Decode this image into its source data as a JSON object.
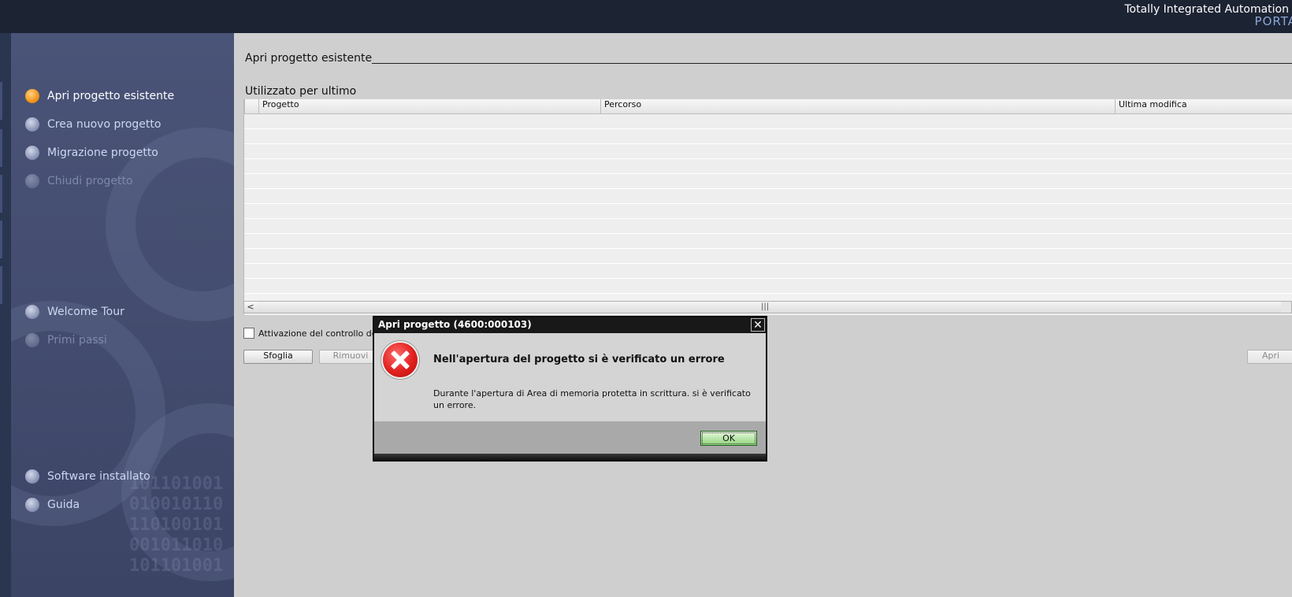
{
  "header": {
    "brand_line1": "Totally Integrated Automation",
    "brand_line2": "PORTA"
  },
  "sidebar": {
    "items": [
      {
        "label": "Apri progetto esistente",
        "state": "active"
      },
      {
        "label": "Crea nuovo progetto",
        "state": "normal"
      },
      {
        "label": "Migrazione progetto",
        "state": "normal"
      },
      {
        "label": "Chiudi progetto",
        "state": "disabled"
      },
      {
        "label": "Welcome Tour",
        "state": "normal"
      },
      {
        "label": "Primi passi",
        "state": "disabled"
      },
      {
        "label": "Software installato",
        "state": "normal"
      },
      {
        "label": "Guida",
        "state": "normal"
      }
    ]
  },
  "main": {
    "section_title": "Apri progetto esistente",
    "recent_title": "Utilizzato per ultimo",
    "table": {
      "columns": [
        "Progetto",
        "Percorso",
        "Ultima modifica"
      ],
      "rows": []
    },
    "checkbox_label": "Attivazione del controllo de",
    "checkbox_checked": false,
    "buttons": {
      "browse": "Sfoglia",
      "remove": "Rimuovi",
      "open": "Apri"
    }
  },
  "dialog": {
    "title": "Apri progetto (4600:000103)",
    "close_glyph": "✕",
    "icon": "error-icon",
    "heading": "Nell'apertura del progetto si è verificato un errore",
    "message": "Durante l'apertura di Area di memoria protetta in scrittura. si è verificato un errore.",
    "ok_label": "OK"
  },
  "colors": {
    "topbar": "#1c2333",
    "sidebar": "#4a5478",
    "active_bullet": "#f29a1e",
    "ok_button": "#8fd47a",
    "error_icon": "#e0201e"
  }
}
